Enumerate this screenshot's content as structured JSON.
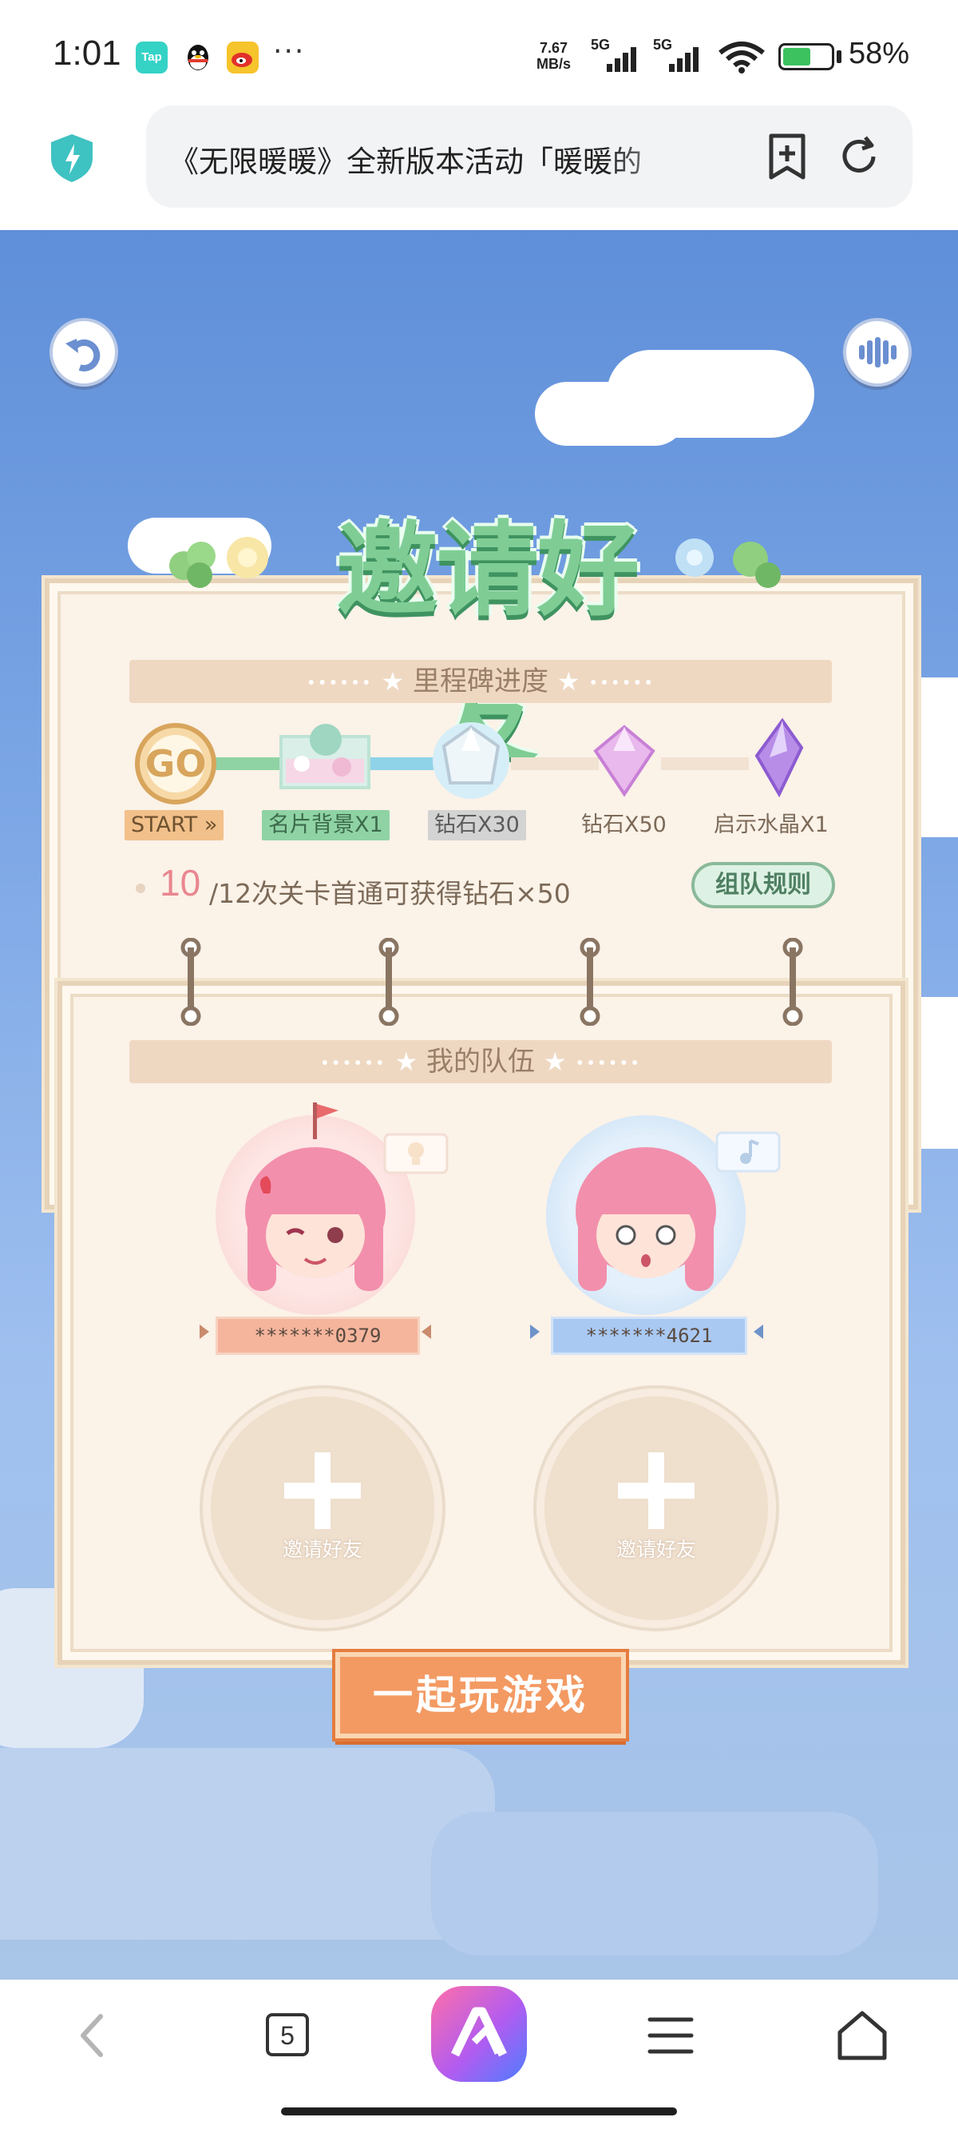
{
  "status_bar": {
    "time": "1:01",
    "apps": [
      "tap-app-icon",
      "qq-icon",
      "weibo-icon"
    ],
    "app_tap_label": "Tap",
    "more": "···",
    "net_speed_value": "7.67",
    "net_speed_unit": "MB/s",
    "sim1": "5G",
    "sim2": "5G",
    "battery_percent": "58%",
    "battery_level": 0.58
  },
  "browser": {
    "page_title": "《无限暖暖》全新版本活动「暖暖的",
    "buttons": [
      "shield-icon",
      "add-bookmark-icon",
      "refresh-icon"
    ]
  },
  "game": {
    "title": "邀请好友",
    "milestone_header": "里程碑进度",
    "milestones": [
      {
        "icon_text": "GO",
        "label": "START »"
      },
      {
        "label": "名片背景X1"
      },
      {
        "label": "钻石X30"
      },
      {
        "label": "钻石X50"
      },
      {
        "label": "启示水晶X1"
      }
    ],
    "progress_current": "10",
    "progress_text": "/12次关卡首通可获得钻石×50",
    "rule_button": "组队规则",
    "team_header": "我的队伍",
    "members": [
      {
        "name": "*******0379"
      },
      {
        "name": "*******4621"
      }
    ],
    "invite_label": "邀请好友",
    "play_button": "一起玩游戏",
    "colors": {
      "sky": "#6f9ce0",
      "panel": "#fbf2e8",
      "title_green": "#7fcd95",
      "accent_orange": "#f39a63",
      "progress_pink": "#e98690"
    }
  },
  "navbar": {
    "tab_count": "5",
    "items": [
      "back-icon",
      "tabs-icon",
      "browser-logo-icon",
      "menu-icon",
      "home-icon"
    ]
  }
}
